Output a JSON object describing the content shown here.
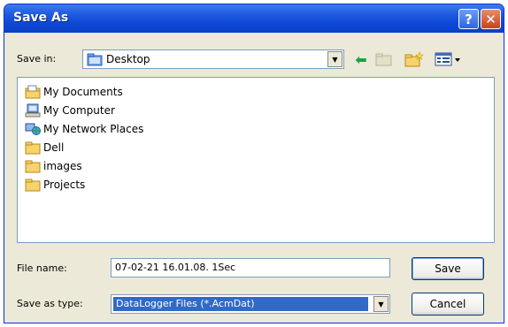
{
  "window": {
    "title": "Save As"
  },
  "titlebar": {
    "help_glyph": "?",
    "close_glyph": "✕"
  },
  "save_in": {
    "label": "Save in:",
    "value": "Desktop",
    "icon": "desktop-folder-icon"
  },
  "toolbar": {
    "icons": [
      "back-arrow-icon",
      "up-folder-icon",
      "new-folder-icon",
      "views-menu-icon"
    ]
  },
  "file_list": {
    "items": [
      {
        "label": "My Documents",
        "icon": "my-documents-icon"
      },
      {
        "label": "My Computer",
        "icon": "my-computer-icon"
      },
      {
        "label": "My Network Places",
        "icon": "network-places-icon"
      },
      {
        "label": "Dell",
        "icon": "folder-icon"
      },
      {
        "label": "images",
        "icon": "folder-icon"
      },
      {
        "label": "Projects",
        "icon": "folder-icon"
      }
    ]
  },
  "file_name": {
    "label": "File name:",
    "value": "07-02-21 16.01.08. 1Sec"
  },
  "save_as_type": {
    "label": "Save as type:",
    "value": "DataLogger Files (*.AcmDat)"
  },
  "buttons": {
    "save": "Save",
    "cancel": "Cancel"
  },
  "colors": {
    "titlebar": "#0c47d4",
    "dialog_bg": "#ece9d8",
    "selection": "#316ac5",
    "folder": "#f6d36b",
    "close": "#c8401a"
  }
}
